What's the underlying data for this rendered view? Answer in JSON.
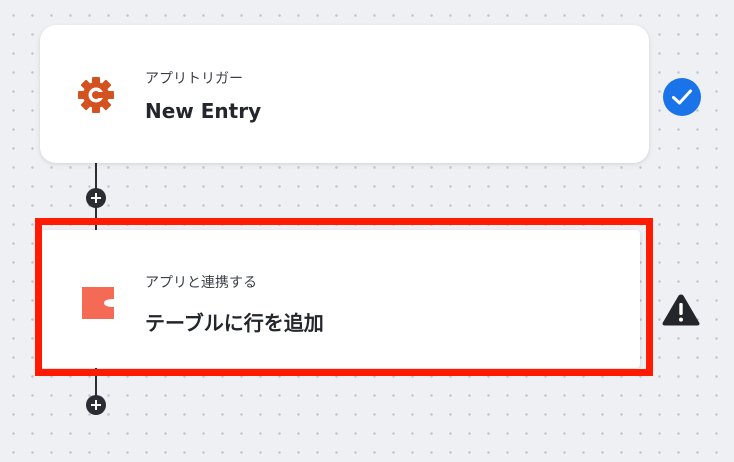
{
  "steps": [
    {
      "label": "アプリトリガー",
      "title": "New Entry",
      "app_icon": "cognito-forms-gear-icon",
      "status": "check-circle-icon",
      "status_color": "#1a73e8",
      "icon_color": "#d3521f"
    },
    {
      "label": "アプリと連携する",
      "title": "テーブルに行を追加",
      "app_icon": "coda-icon",
      "status": "warning-triangle-icon",
      "status_color": "#23262b",
      "icon_color": "#f46a54"
    }
  ],
  "add_step_icon": "plus-icon",
  "highlight_color": "#ff1a00"
}
